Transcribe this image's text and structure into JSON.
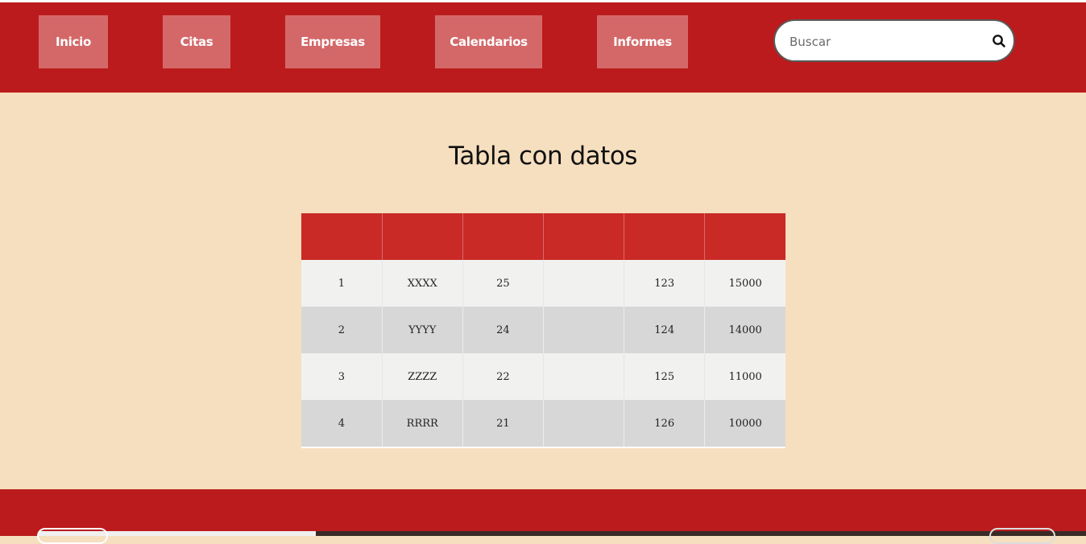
{
  "nav": {
    "items": [
      {
        "label": "Inicio"
      },
      {
        "label": "Citas"
      },
      {
        "label": "Empresas"
      },
      {
        "label": "Calendarios"
      },
      {
        "label": "Informes"
      }
    ]
  },
  "search": {
    "placeholder": "Buscar",
    "value": "",
    "icon": "search-icon"
  },
  "main": {
    "title": "Tabla con datos"
  },
  "table": {
    "headers": [
      "",
      "",
      "",
      "",
      "",
      ""
    ],
    "rows": [
      [
        "1",
        "XXXX",
        "25",
        "",
        "123",
        "15000"
      ],
      [
        "2",
        "YYYY",
        "24",
        "",
        "124",
        "14000"
      ],
      [
        "3",
        "ZZZZ",
        "22",
        "",
        "125",
        "11000"
      ],
      [
        "4",
        "RRRR",
        "21",
        "",
        "126",
        "10000"
      ]
    ]
  },
  "colors": {
    "header_bg": "#bb1b1c",
    "nav_button_bg": "#d46869",
    "page_bg": "#f6dfbf",
    "table_header_bg": "#c92a26",
    "row_odd_bg": "#f1f1f0",
    "row_even_bg": "#d7d7d7"
  }
}
